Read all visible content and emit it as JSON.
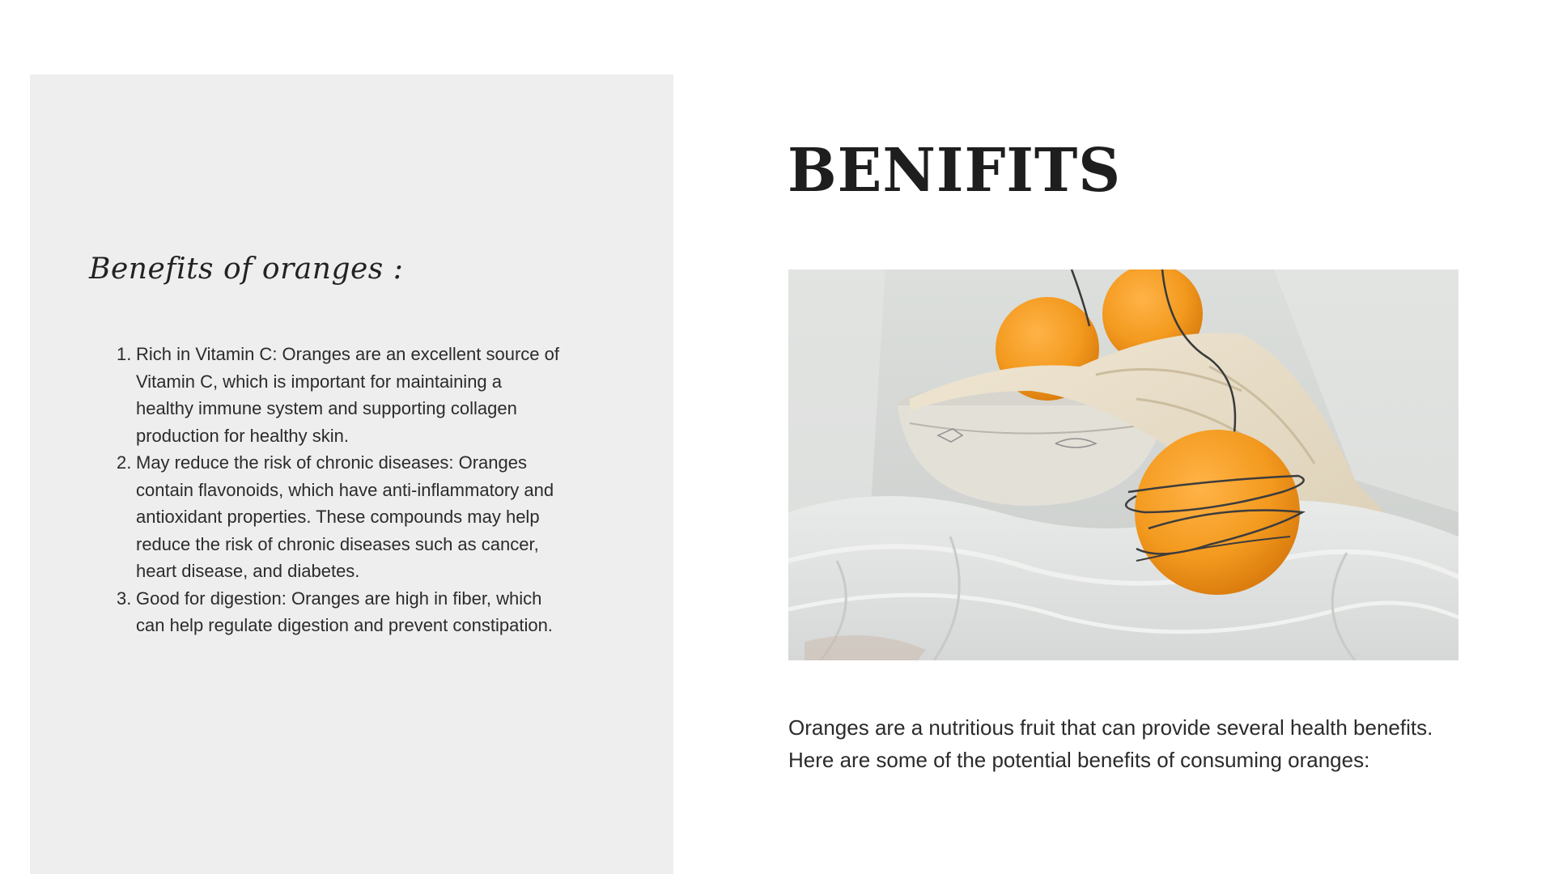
{
  "left": {
    "subtitle": "Benefits of oranges :",
    "items": [
      {
        "number": "1.",
        "text": "Rich in Vitamin C: Oranges are an excellent source of Vitamin C, which is important for maintaining a healthy immune system and supporting collagen production for healthy skin."
      },
      {
        "number": "2.",
        "text": "May reduce the risk of chronic diseases: Oranges contain flavonoids, which have anti-inflammatory and antioxidant properties. These compounds may help reduce the risk of chronic diseases such as cancer, heart disease, and diabetes."
      },
      {
        "number": "3.",
        "text": "Good for digestion: Oranges are high in fiber, which can help regulate digestion and prevent constipation."
      }
    ]
  },
  "right": {
    "heading": "BENIFITS",
    "intro": "Oranges are a nutritious fruit that can provide several health benefits. Here are some of the potential benefits of consuming oranges:"
  },
  "colors": {
    "panel": "#eeeeee",
    "text": "#2b2b2b",
    "orange": "#f39a1f"
  }
}
